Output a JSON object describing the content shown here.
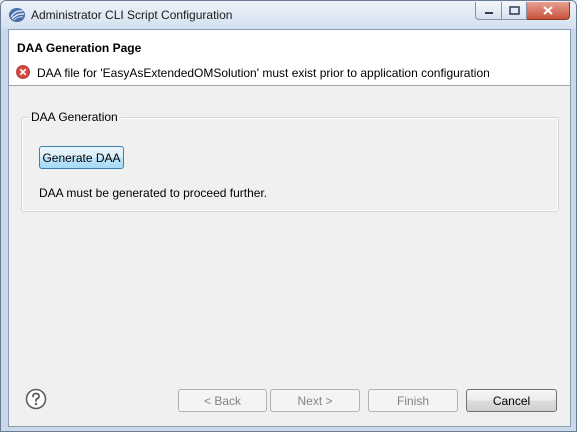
{
  "window": {
    "title": "Administrator CLI Script Configuration",
    "icon": "eclipse-app-icon"
  },
  "header": {
    "page_title": "DAA Generation Page",
    "error_message": "DAA file for 'EasyAsExtendedOMSolution' must exist prior to application configuration",
    "error_icon": "error-icon"
  },
  "group": {
    "label": "DAA Generation",
    "generate_button": "Generate DAA",
    "hint": "DAA must be generated to proceed further."
  },
  "footer": {
    "help_icon": "help-icon",
    "back_label": "< Back",
    "next_label": "Next >",
    "finish_label": "Finish",
    "cancel_label": "Cancel"
  },
  "colors": {
    "error_red": "#d9453d",
    "focus_blue": "#3c7fb1"
  }
}
